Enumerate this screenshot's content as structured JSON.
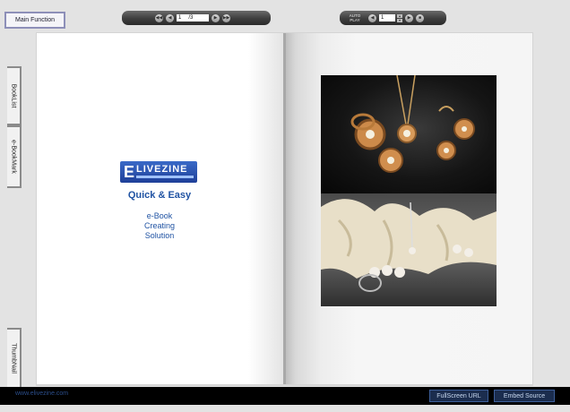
{
  "toolbar": {
    "main_function_label": "Main Function",
    "current_page": "1",
    "total_pages": "/3",
    "auto_play_line1": "AUTO",
    "auto_play_line2": "PLAY",
    "auto_play_interval": "1"
  },
  "side_tabs": {
    "booklist": "BookList",
    "ebookmark": "e-BookMark",
    "thumbnail": "ThumbNail"
  },
  "left_page": {
    "logo_letter": "E",
    "logo_word": "LIVEZINE",
    "tagline": "Quick & Easy",
    "subtitle_lines": [
      "e-Book",
      "Creating",
      "Solution"
    ]
  },
  "right_page": {
    "photo_top_icon": "gold-jewelry-photo",
    "photo_bottom_icon": "pearl-jewelry-on-coral-photo"
  },
  "footer": {
    "site": "www.elivezine.com",
    "fullscreen_url_label": "FullScreen URL",
    "embed_source_label": "Embed Source"
  },
  "icons": {
    "first": "◀◀",
    "prev": "◀",
    "next": "▶",
    "last": "▶▶",
    "stop": "■",
    "up": "▲",
    "down": "▼"
  },
  "colors": {
    "accent_blue": "#2053a3",
    "footer_bg": "#000000",
    "toolbar": "#3e3e3e"
  }
}
